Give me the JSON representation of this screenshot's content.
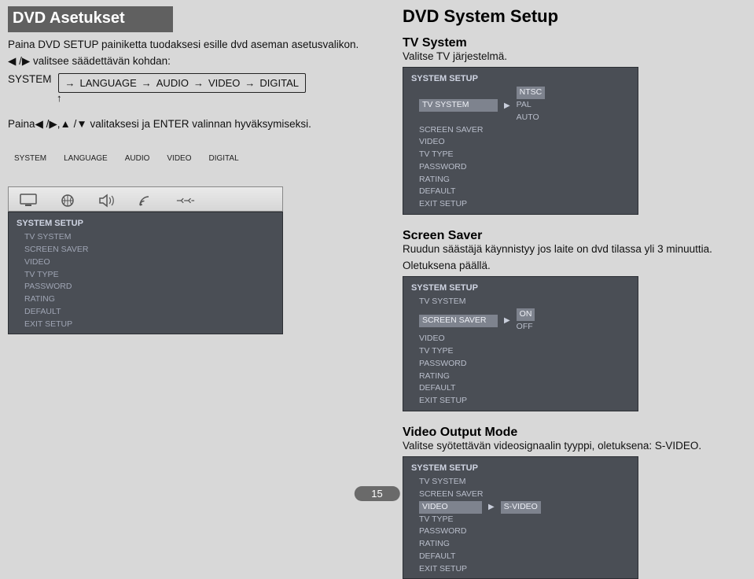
{
  "left": {
    "title": "DVD Asetukset",
    "desc_line1": "Paina DVD SETUP painiketta tuodaksesi esille dvd aseman asetusvalikon.",
    "desc_line2": "◀ /▶ valitsee säädettävän kohdan:",
    "flow_prefix": "SYSTEM",
    "flow": {
      "a": "LANGUAGE",
      "b": "AUDIO",
      "c": "VIDEO",
      "d": "DIGITAL"
    },
    "instruction": "Paina◀ /▶,▲ /▼ valitaksesi ja ENTER valinnan hyväksymiseksi.",
    "tabs": {
      "a": "SYSTEM",
      "b": "LANGUAGE",
      "c": "AUDIO",
      "d": "VIDEO",
      "e": "DIGITAL"
    },
    "osd": {
      "title": "SYSTEM SETUP",
      "items": {
        "i0": "TV SYSTEM",
        "i1": "SCREEN SAVER",
        "i2": "VIDEO",
        "i3": "TV TYPE",
        "i4": "PASSWORD",
        "i5": "RATING",
        "i6": "DEFAULT",
        "i7": "EXIT  SETUP"
      }
    }
  },
  "right": {
    "title": "DVD System Setup",
    "tvsys": {
      "heading": "TV System",
      "desc": "Valitse TV järjestelmä.",
      "osd_title": "SYSTEM SETUP",
      "sel": "TV SYSTEM",
      "opts": {
        "o0": "NTSC",
        "o1": "PAL",
        "o2": "AUTO"
      },
      "items": {
        "i1": "SCREEN SAVER",
        "i2": "VIDEO",
        "i3": "TV TYPE",
        "i4": "PASSWORD",
        "i5": "RATING",
        "i6": "DEFAULT",
        "i7": "EXIT  SETUP"
      }
    },
    "saver": {
      "heading": "Screen Saver",
      "desc1": "Ruudun säästäjä käynnistyy jos laite on dvd tilassa yli 3 minuuttia.",
      "desc2": "Oletuksena päällä.",
      "osd_title": "SYSTEM SETUP",
      "i0": "TV SYSTEM",
      "sel": "SCREEN SAVER",
      "opts": {
        "o0": "ON",
        "o1": "OFF"
      },
      "items": {
        "i2": "VIDEO",
        "i3": "TV TYPE",
        "i4": "PASSWORD",
        "i5": "RATING",
        "i6": "DEFAULT",
        "i7": "EXIT  SETUP"
      }
    },
    "video": {
      "heading": "Video Output Mode",
      "desc": "Valitse syötettävän videosignaalin tyyppi, oletuksena: S-VIDEO.",
      "osd_title": "SYSTEM SETUP",
      "i0": "TV SYSTEM",
      "i1": "SCREEN SAVER",
      "sel": "VIDEO",
      "opts": {
        "o0": "S-VIDEO"
      },
      "items": {
        "i3": "TV TYPE",
        "i4": "PASSWORD",
        "i5": "RATING",
        "i6": "DEFAULT",
        "i7": "EXIT  SETUP"
      }
    }
  },
  "page_number": "15"
}
